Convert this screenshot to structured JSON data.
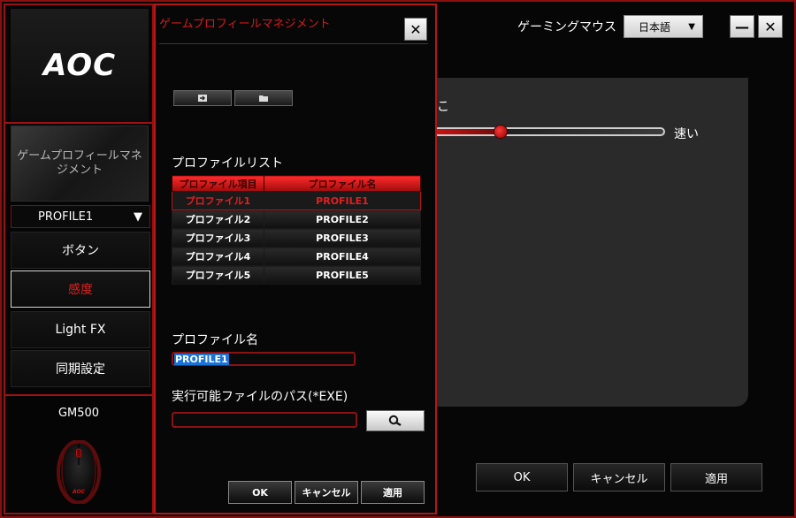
{
  "sidebar": {
    "logo": "AOC",
    "profile_management": "ゲームプロフィールマネジメント",
    "profile_selected": "PROFILE1",
    "nav": [
      {
        "label": "ボタン"
      },
      {
        "label": "感度"
      },
      {
        "label": "Light FX"
      },
      {
        "label": "同期設定"
      }
    ],
    "active_nav": "感度",
    "model": "GM500",
    "mouse_logo": "AOC"
  },
  "header": {
    "device": "ゲーミングマウス",
    "language": "日本語"
  },
  "main": {
    "label_fragment": "こ",
    "slider_max_label": "速い",
    "slider_value_fraction": 0.29,
    "buttons": {
      "ok": "OK",
      "cancel": "キャンセル",
      "apply": "適用"
    }
  },
  "dialog": {
    "title": "ゲームプロフィールマネジメント",
    "list_label": "プロファイルリスト",
    "table": {
      "headers": [
        "プロファイル項目",
        "プロファイル名"
      ],
      "rows": [
        [
          "プロファイル1",
          "PROFILE1"
        ],
        [
          "プロファイル2",
          "PROFILE2"
        ],
        [
          "プロファイル3",
          "PROFILE3"
        ],
        [
          "プロファイル4",
          "PROFILE4"
        ],
        [
          "プロファイル5",
          "PROFILE5"
        ]
      ],
      "selected_index": 0
    },
    "name_label": "プロファイル名",
    "name_value": "PROFILE1",
    "exe_label": "実行可能ファイルのパス(*EXE)",
    "exe_value": "",
    "buttons": {
      "ok": "OK",
      "cancel": "キャンセル",
      "apply": "適用"
    }
  },
  "colors": {
    "accent_red": "#b51515",
    "active_text": "#e02020",
    "selection_blue": "#1874d8"
  }
}
